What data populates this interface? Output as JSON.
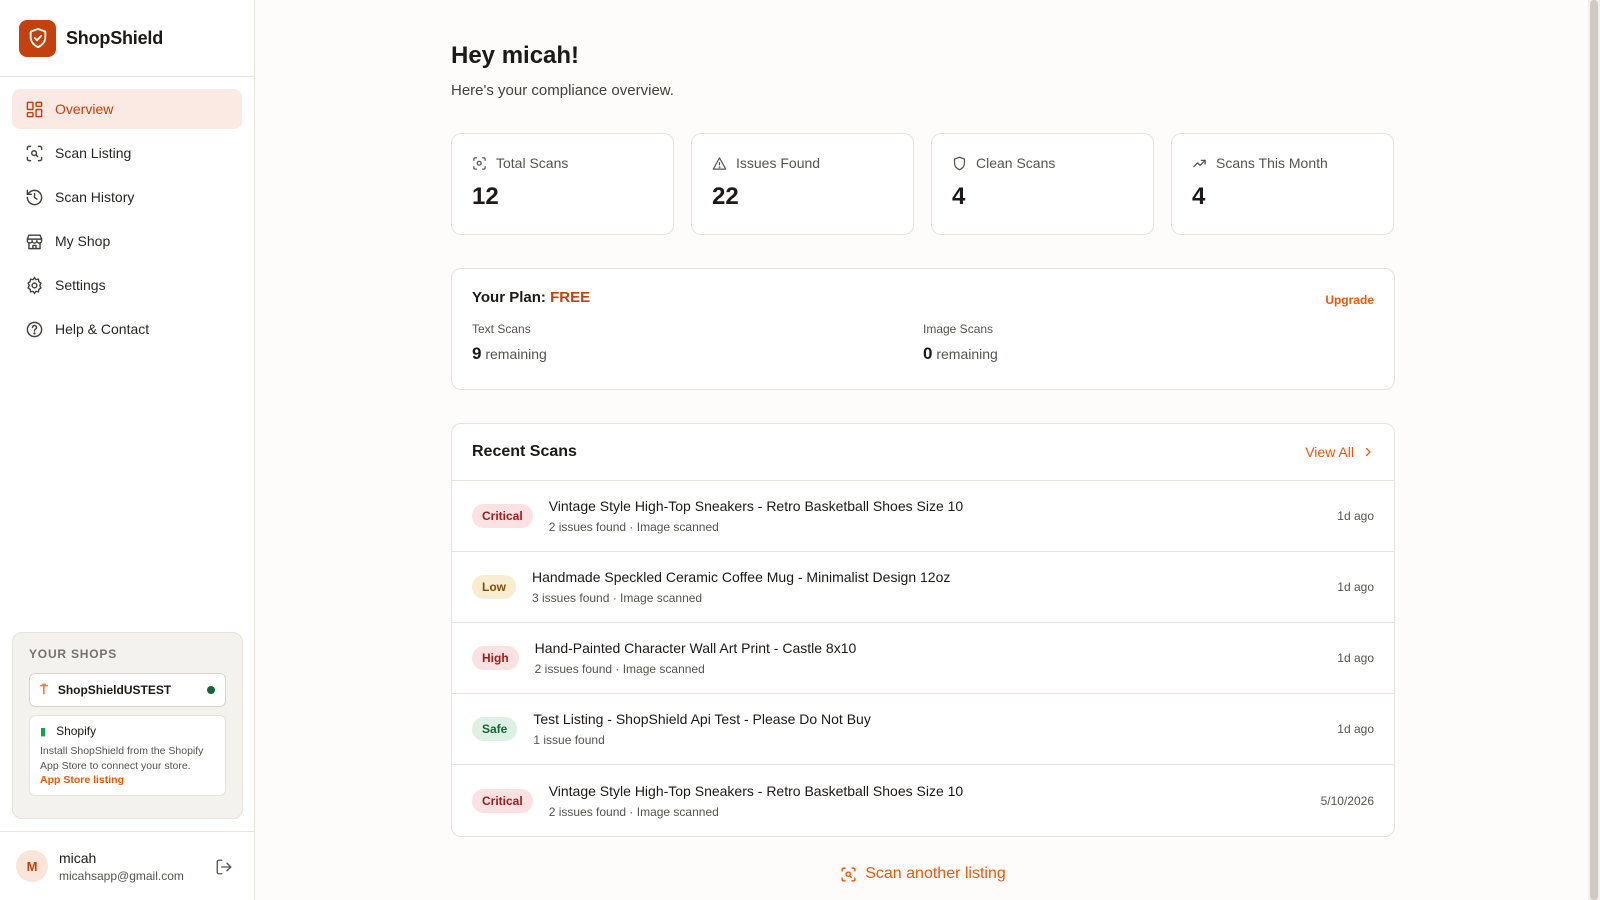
{
  "brand": {
    "name": "ShopShield",
    "icon": "shield-check-icon",
    "color": "#c2410c"
  },
  "sidebar": {
    "items": [
      {
        "label": "Overview",
        "icon": "grid-icon",
        "active": true
      },
      {
        "label": "Scan Listing",
        "icon": "scan-icon"
      },
      {
        "label": "Scan History",
        "icon": "history-icon"
      },
      {
        "label": "My Shop",
        "icon": "store-icon"
      },
      {
        "label": "Settings",
        "icon": "gear-icon"
      },
      {
        "label": "Help & Contact",
        "icon": "help-icon"
      }
    ],
    "shops": {
      "title": "YOUR SHOPS",
      "active_shop": "ShopShieldUSTEST",
      "shopify": {
        "name": "Shopify",
        "description": "Install ShopShield from the Shopify App Store to connect your store.",
        "link": "App Store listing"
      }
    },
    "user": {
      "initial": "M",
      "name": "micah",
      "email": "micahsapp@gmail.com"
    }
  },
  "main": {
    "greeting": "Hey micah!",
    "subtitle": "Here's your compliance overview.",
    "stats": [
      {
        "label": "Total Scans",
        "value": "12",
        "icon": "scan-icon"
      },
      {
        "label": "Issues Found",
        "value": "22",
        "icon": "warning-icon"
      },
      {
        "label": "Clean Scans",
        "value": "4",
        "icon": "shield-icon"
      },
      {
        "label": "Scans This Month",
        "value": "4",
        "icon": "trending-up-icon"
      }
    ],
    "plan": {
      "label": "Your Plan:",
      "tier": "FREE",
      "upgrade": "Upgrade",
      "text_scans_label": "Text Scans",
      "text_scans_count": "9",
      "image_scans_label": "Image Scans",
      "image_scans_count": "0",
      "remaining_word": "remaining"
    },
    "recent": {
      "title": "Recent Scans",
      "view_all": "View All",
      "rows": [
        {
          "badge": "Critical",
          "severity": "critical",
          "title": "Vintage Style High-Top Sneakers - Retro Basketball Shoes Size 10",
          "sub": "2 issues found · Image scanned",
          "time": "1d ago"
        },
        {
          "badge": "Low",
          "severity": "low",
          "title": "Handmade Speckled Ceramic Coffee Mug - Minimalist Design 12oz",
          "sub": "3 issues found · Image scanned",
          "time": "1d ago"
        },
        {
          "badge": "High",
          "severity": "high",
          "title": "Hand-Painted Character Wall Art Print - Castle 8x10",
          "sub": "2 issues found · Image scanned",
          "time": "1d ago"
        },
        {
          "badge": "Safe",
          "severity": "safe",
          "title": "Test Listing - ShopShield Api Test - Please Do Not Buy",
          "sub": "1 issue found",
          "time": "1d ago"
        },
        {
          "badge": "Critical",
          "severity": "critical",
          "title": "Vintage Style High-Top Sneakers - Retro Basketball Shoes Size 10",
          "sub": "2 issues found · Image scanned",
          "time": "5/10/2026"
        }
      ]
    },
    "scan_another": "Scan another listing"
  },
  "colors": {
    "accent": "#ea580c",
    "accent_dark": "#c2410c",
    "active_nav_bg": "#fbe9e3"
  }
}
